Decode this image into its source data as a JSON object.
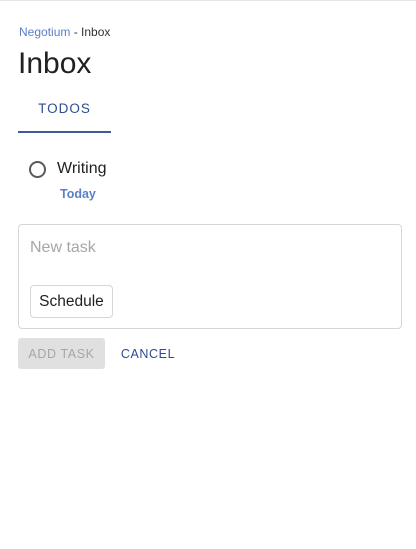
{
  "breadcrumb": {
    "app_name": "Negotium",
    "separator": " - ",
    "current": "Inbox"
  },
  "page_title": "Inbox",
  "tabs": [
    {
      "label": "TODOS",
      "active": true
    }
  ],
  "todos": [
    {
      "title": "Writing",
      "due": "Today",
      "completed": false
    }
  ],
  "composer": {
    "input_value": "",
    "input_placeholder": "New task",
    "schedule_label": "Schedule"
  },
  "actions": {
    "add_task_label": "ADD TASK",
    "add_task_disabled": true,
    "cancel_label": "CANCEL"
  },
  "colors": {
    "link": "#5b7fc7",
    "accent": "#2f4c8f",
    "disabled_bg": "#e0e0e0",
    "disabled_text": "#a6a6a6",
    "border": "#d6d6d6"
  }
}
